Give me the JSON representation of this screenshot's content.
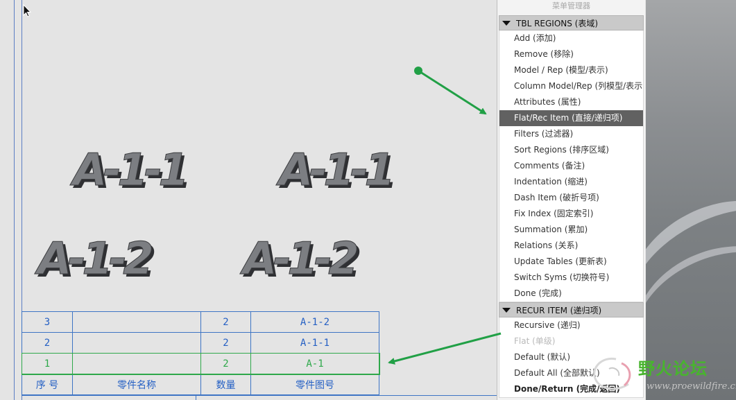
{
  "menu_manager": {
    "title": "菜单管理器",
    "sections": [
      {
        "header": "TBL REGIONS (表域)",
        "items": [
          {
            "label": "Add (添加)",
            "state": "normal"
          },
          {
            "label": "Remove (移除)",
            "state": "normal"
          },
          {
            "label": "Model / Rep (模型/表示)",
            "state": "normal"
          },
          {
            "label": "Column Model/Rep (列模型/表示",
            "state": "normal"
          },
          {
            "label": "Attributes (属性)",
            "state": "normal"
          },
          {
            "label": "Flat/Rec Item (直接/递归项)",
            "state": "selected"
          },
          {
            "label": "Filters (过滤器)",
            "state": "normal"
          },
          {
            "label": "Sort Regions (排序区域)",
            "state": "normal"
          },
          {
            "label": "Comments (备注)",
            "state": "normal"
          },
          {
            "label": "Indentation (缩进)",
            "state": "normal"
          },
          {
            "label": "Dash Item (破折号项)",
            "state": "normal"
          },
          {
            "label": "Fix Index (固定索引)",
            "state": "normal"
          },
          {
            "label": "Summation (累加)",
            "state": "normal"
          },
          {
            "label": "Relations (关系)",
            "state": "normal"
          },
          {
            "label": "Update Tables (更新表)",
            "state": "normal"
          },
          {
            "label": "Switch Syms (切换符号)",
            "state": "normal"
          },
          {
            "label": "Done (完成)",
            "state": "normal"
          }
        ]
      },
      {
        "header": "RECUR ITEM (递归项)",
        "items": [
          {
            "label": "Recursive (递归)",
            "state": "normal"
          },
          {
            "label": "Flat (单级)",
            "state": "disabled"
          },
          {
            "label": "Default (默认)",
            "state": "normal"
          },
          {
            "label": "Default All (全部默认)",
            "state": "normal"
          },
          {
            "label": "Done/Return (完成/返回)",
            "state": "bold"
          }
        ]
      }
    ]
  },
  "drawing": {
    "model_labels": [
      "A-1-1",
      "A-1-1",
      "A-1-2",
      "A-1-2"
    ]
  },
  "bom_table": {
    "rows": [
      [
        "3",
        "",
        "2",
        "A-1-2"
      ],
      [
        "2",
        "",
        "2",
        "A-1-1"
      ],
      [
        "1",
        "",
        "2",
        "A-1"
      ]
    ],
    "highlighted_row": 2,
    "header": [
      "序  号",
      "零件名称",
      "数量",
      "零件图号"
    ]
  },
  "watermark": {
    "title": "野火论坛",
    "url": "www.proewildfire.cn"
  },
  "colors": {
    "table_line": "#3d74c4",
    "highlight": "#2ea84a",
    "arrow": "#21a046",
    "selected_item_bg": "#616161"
  }
}
